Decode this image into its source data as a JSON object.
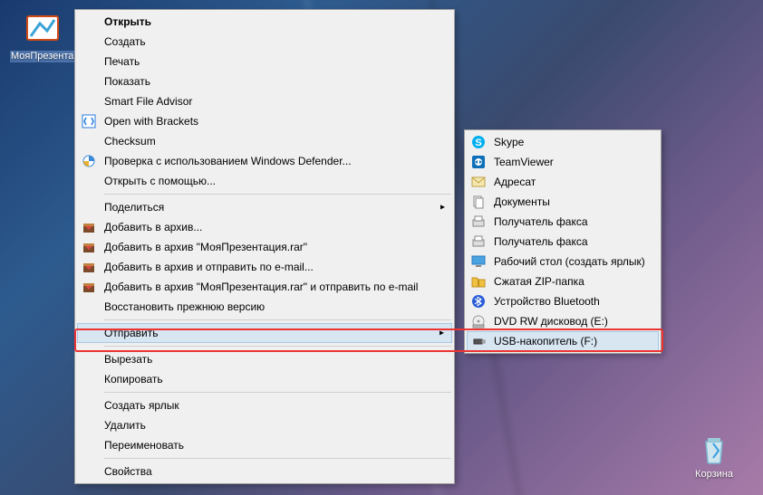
{
  "desktop": {
    "file_icon_label": "МояПрезентация.pptx",
    "recycle_label": "Корзина"
  },
  "main_menu": {
    "open": "Открыть",
    "create": "Создать",
    "print": "Печать",
    "show": "Показать",
    "smart_file_advisor": "Smart File Advisor",
    "open_with_brackets": "Open with Brackets",
    "checksum": "Checksum",
    "defender": "Проверка с использованием Windows Defender...",
    "open_with": "Открыть с помощью...",
    "share": "Поделиться",
    "add_to_archive": "Добавить в архив...",
    "add_to_rar": "Добавить в архив \"МояПрезентация.rar\"",
    "add_and_email": "Добавить в архив и отправить по e-mail...",
    "add_rar_email": "Добавить в архив \"МояПрезентация.rar\" и отправить по e-mail",
    "restore": "Восстановить прежнюю версию",
    "send_to": "Отправить",
    "cut": "Вырезать",
    "copy": "Копировать",
    "shortcut": "Создать ярлык",
    "delete": "Удалить",
    "rename": "Переименовать",
    "properties": "Свойства"
  },
  "sub_menu": {
    "skype": "Skype",
    "teamviewer": "TeamViewer",
    "recipient": "Адресат",
    "documents": "Документы",
    "fax1": "Получатель факса",
    "fax2": "Получатель факса",
    "desktop_link": "Рабочий стол (создать ярлык)",
    "zip": "Сжатая ZIP-папка",
    "bluetooth": "Устройство Bluetooth",
    "dvd": "DVD RW дисковод (E:)",
    "usb": "USB-накопитель (F:)"
  }
}
